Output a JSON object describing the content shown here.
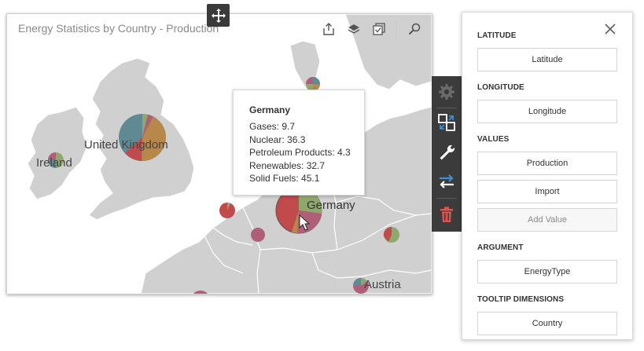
{
  "map": {
    "title": "Energy Statistics by Country - Production",
    "labels": {
      "ireland": "Ireland",
      "united_kingdom": "United Kingdom",
      "germany": "Germany",
      "austria": "Austria"
    },
    "toolbar_icons": [
      "export-icon",
      "layers-icon",
      "multiselect-icon",
      "zoom-icon"
    ]
  },
  "tooltip": {
    "title": "Germany",
    "lines": [
      "Gases: 9.7",
      "Nuclear: 36.3",
      "Petroleum Products: 4.3",
      "Renewables: 32.7",
      "Solid Fuels: 45.1"
    ]
  },
  "side_bar": {
    "icons": [
      "gear-icon",
      "convert-icon",
      "wrench-icon",
      "swap-icon",
      "trash-icon"
    ]
  },
  "panel": {
    "sections": {
      "latitude": {
        "label": "LATITUDE",
        "items": [
          "Latitude"
        ]
      },
      "longitude": {
        "label": "LONGITUDE",
        "items": [
          "Longitude"
        ]
      },
      "values": {
        "label": "VALUES",
        "items": [
          "Production",
          "Import"
        ],
        "add": "Add Value"
      },
      "argument": {
        "label": "ARGUMENT",
        "items": [
          "EnergyType"
        ]
      },
      "tooltip_dimensions": {
        "label": "TOOLTIP DIMENSIONS",
        "items": [
          "Country"
        ]
      }
    }
  },
  "colors": {
    "land": "#d0d0d0",
    "sea": "#ffffff",
    "accent_red": "#c84b4b",
    "panel_dark": "#3b3b3b",
    "icon_blue": "#3d8fd8",
    "icon_red": "#d9534f"
  }
}
